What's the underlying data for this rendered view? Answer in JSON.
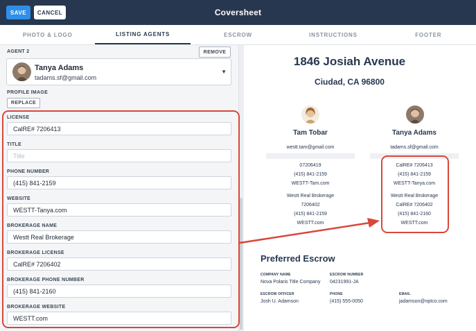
{
  "header": {
    "title": "Coversheet",
    "save_label": "SAVE",
    "cancel_label": "CANCEL"
  },
  "tabs": [
    {
      "label": "PHOTO & LOGO",
      "active": false
    },
    {
      "label": "LISTING AGENTS",
      "active": true
    },
    {
      "label": "ESCROW",
      "active": false
    },
    {
      "label": "INSTRUCTIONS",
      "active": false
    },
    {
      "label": "FOOTER",
      "active": false
    }
  ],
  "form": {
    "agent_label": "AGENT 2",
    "remove_label": "REMOVE",
    "selected_agent": {
      "name": "Tanya Adams",
      "email": "tadams.sf@gmail.com"
    },
    "profile_image_label": "PROFILE IMAGE",
    "replace_label": "REPLACE",
    "fields": [
      {
        "label": "LICENSE",
        "value": "CalRE# 7206413",
        "placeholder": ""
      },
      {
        "label": "TITLE",
        "value": "",
        "placeholder": "Title"
      },
      {
        "label": "PHONE NUMBER",
        "value": "(415) 841-2159",
        "placeholder": ""
      },
      {
        "label": "WEBSITE",
        "value": "WESTT-Tanya.com",
        "placeholder": ""
      },
      {
        "label": "BROKERAGE NAME",
        "value": "Westt Real Brokerage",
        "placeholder": ""
      },
      {
        "label": "BROKERAGE LICENSE",
        "value": "CalRE# 7206402",
        "placeholder": ""
      },
      {
        "label": "BROKERAGE PHONE NUMBER",
        "value": "(415) 841-2160",
        "placeholder": ""
      },
      {
        "label": "BROKERAGE WEBSITE",
        "value": "WESTT.com",
        "placeholder": ""
      }
    ]
  },
  "preview": {
    "address": "1846 Josiah Avenue",
    "city": "Ciudad, CA 96800",
    "agents": [
      {
        "name": "Tam Tobar",
        "email": "westt.tam@gmail.com",
        "lines_a": [
          "07206419",
          "(415) 841-2159",
          "WESTT-Tam.com"
        ],
        "lines_b": [
          "Westt Real Brokerage",
          "7206402",
          "(415) 841-2159",
          "WESTT.com"
        ]
      },
      {
        "name": "Tanya Adams",
        "email": "tadams.sf@gmail.com",
        "lines_a": [
          "CalRE# 7206413",
          "(415) 841-2159",
          "WESTT-Tanya.com"
        ],
        "lines_b": [
          "Westt Real Brokerage",
          "CalRE# 7206402",
          "(415) 841-2160",
          "WESTT.com"
        ]
      }
    ],
    "escrow": {
      "title": "Preferred Escrow",
      "company_name_label": "COMPANY NAME",
      "company_name": "Nova Polaris Title Company",
      "escrow_number_label": "ESCROW NUMBER",
      "escrow_number": "04231991-JA",
      "escrow_officer_label": "ESCROW OFFICER",
      "escrow_officer": "Josh U. Adamson",
      "phone_label": "PHONE",
      "phone": "(415) 555-0050",
      "email_label": "EMAIL",
      "email": "jadamson@nptco.com"
    }
  },
  "colors": {
    "navy": "#27374f",
    "save_blue": "#2f8fea",
    "highlight_red": "#d9463b"
  }
}
